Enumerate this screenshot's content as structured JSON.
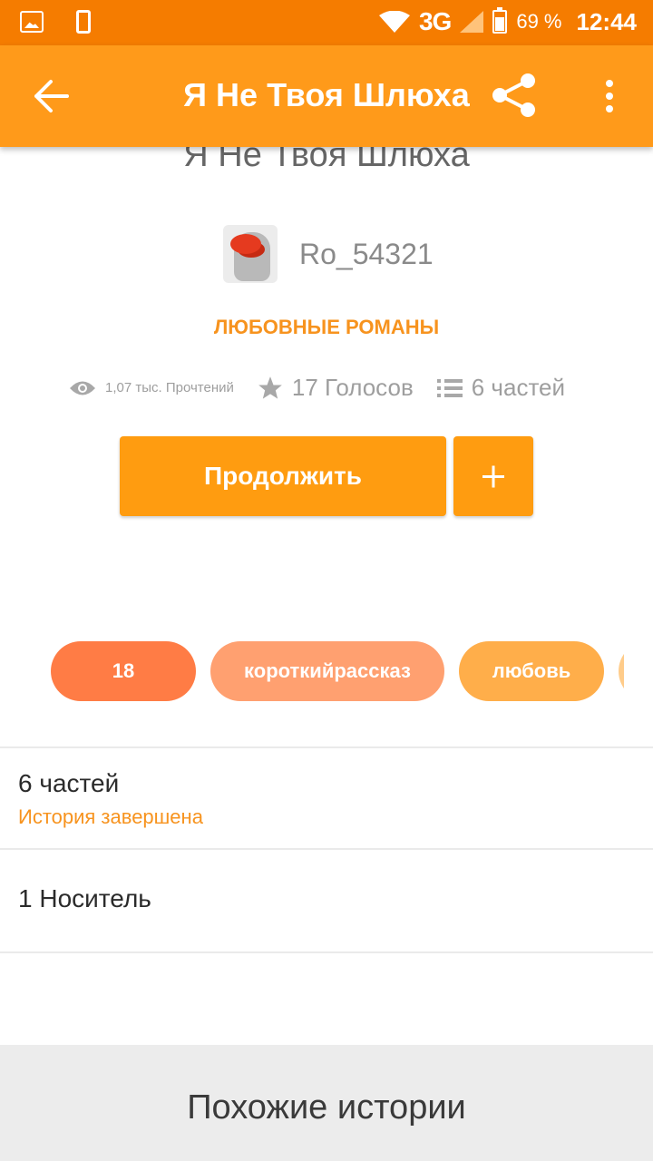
{
  "status_bar": {
    "network": "3G",
    "battery_pct": "69 %",
    "battery_level": 0.69,
    "time": "12:44",
    "icons": [
      "image-icon",
      "phone-icon",
      "wifi-icon",
      "signal-icon",
      "battery-icon"
    ]
  },
  "app_bar": {
    "title": "Я Не Твоя Шлюха",
    "icons": [
      "back-arrow-icon",
      "share-icon",
      "more-vert-icon"
    ],
    "background": "#ff9a1a"
  },
  "story": {
    "title": "Я Не Твоя Шлюха",
    "author": "Ro_54321",
    "genre": "ЛЮБОВНЫЕ РОМАНЫ",
    "stats": {
      "reads": "1,07 тыс. Прочтений",
      "votes": "17 Голосов",
      "parts": "6 частей"
    },
    "continue_label": "Продолжить",
    "tags": [
      {
        "label": "18",
        "color": "#ff7c45"
      },
      {
        "label": "короткийрассказ",
        "color": "#ffa070"
      },
      {
        "label": "любовь",
        "color": "#ffae4a"
      }
    ]
  },
  "details": {
    "parts_count": "6 частей",
    "status": "История завершена",
    "readers": "1 Носитель"
  },
  "similar": {
    "title": "Похожие истории"
  },
  "colors": {
    "accent": "#ff9c10",
    "status_bar": "#f57c00",
    "genre_text": "#f7931e"
  }
}
